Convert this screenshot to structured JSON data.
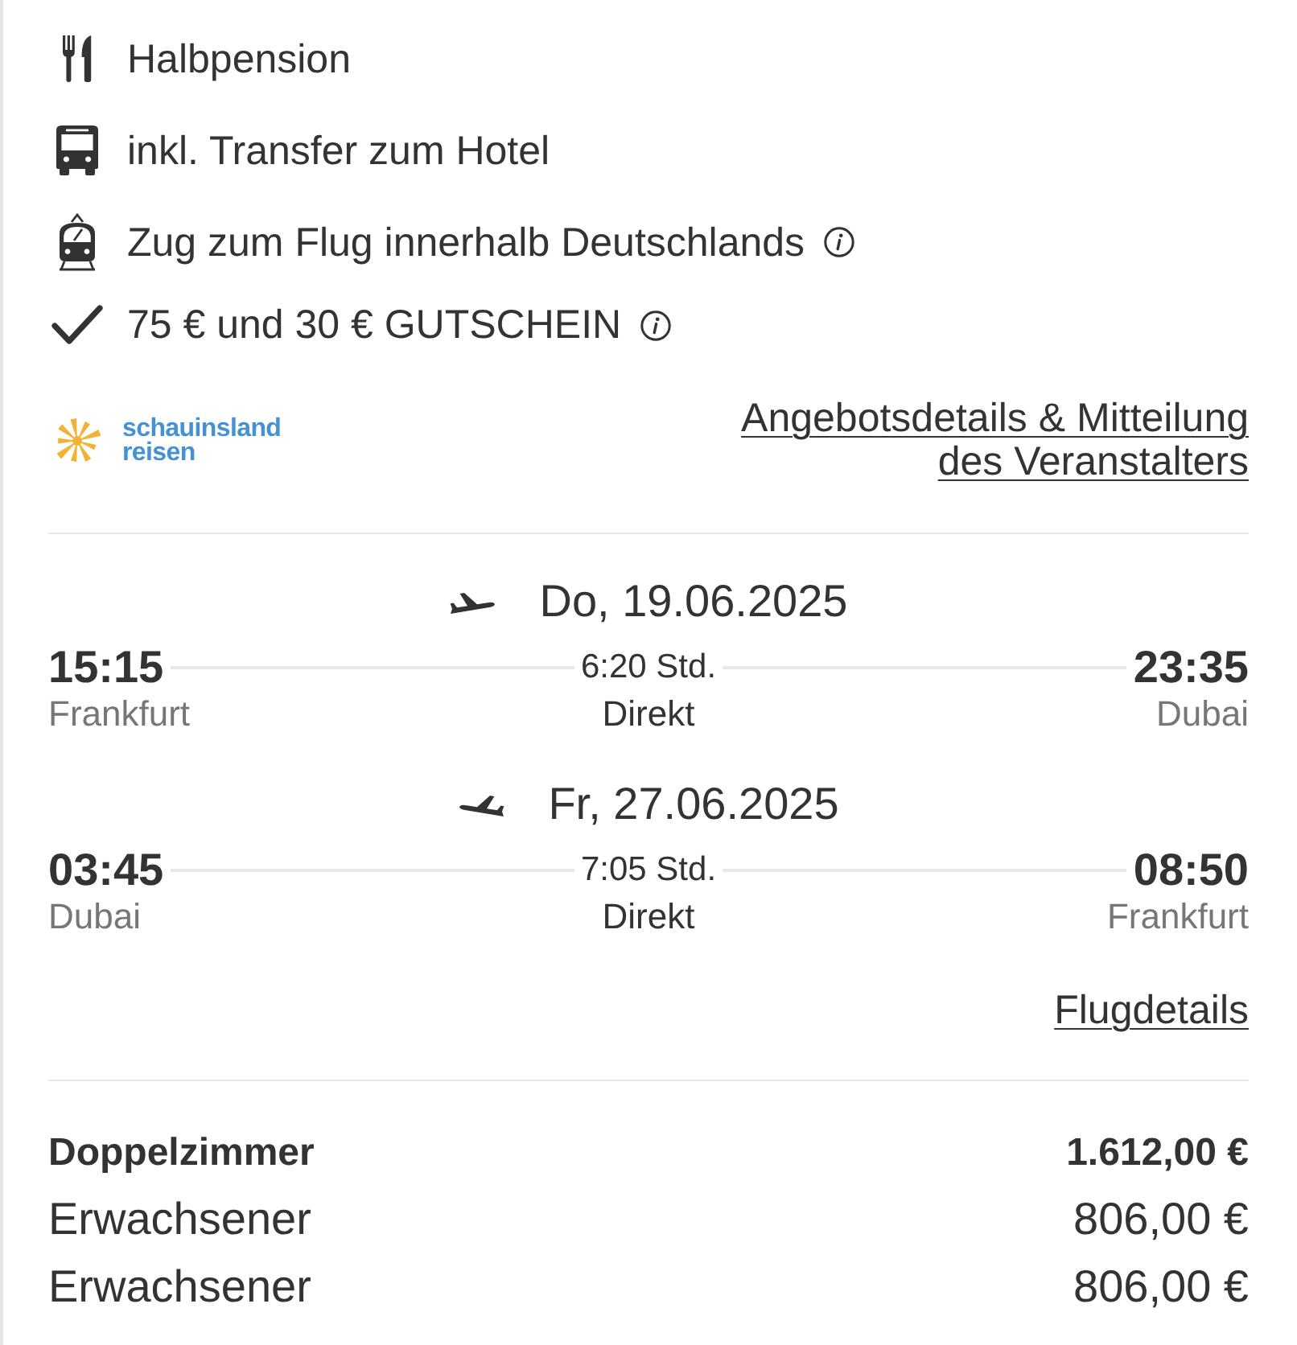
{
  "features": [
    {
      "kind": "meal",
      "text": "Halbpension",
      "info": false
    },
    {
      "kind": "transfer",
      "text": "inkl. Transfer zum Hotel",
      "info": false
    },
    {
      "kind": "train",
      "text": "Zug zum Flug innerhalb Deutschlands",
      "info": true
    },
    {
      "kind": "voucher",
      "text": "75 € und 30 € GUTSCHEIN",
      "info": true
    }
  ],
  "operator": {
    "logo_text": [
      "schauinsland",
      "reisen"
    ],
    "details_link": "Angebotsdetails & Mitteilung des Veranstalters"
  },
  "flights": [
    {
      "kind": "outbound",
      "date": "Do, 19.06.2025",
      "departure_time": "15:15",
      "departure_city": "Frankfurt",
      "duration": "6:20 Std.",
      "stops": "Direkt",
      "arrival_time": "23:35",
      "arrival_city": "Dubai"
    },
    {
      "kind": "return",
      "date": "Fr, 27.06.2025",
      "departure_time": "03:45",
      "departure_city": "Dubai",
      "duration": "7:05 Std.",
      "stops": "Direkt",
      "arrival_time": "08:50",
      "arrival_city": "Frankfurt"
    }
  ],
  "flight_details_link": "Flugdetails",
  "prices": [
    {
      "kind": "room",
      "label": "Doppelzimmer",
      "amount": "1.612,00 €"
    },
    {
      "kind": "traveller",
      "label": "Erwachsener",
      "amount": "806,00 €"
    },
    {
      "kind": "traveller",
      "label": "Erwachsener",
      "amount": "806,00 €"
    }
  ]
}
